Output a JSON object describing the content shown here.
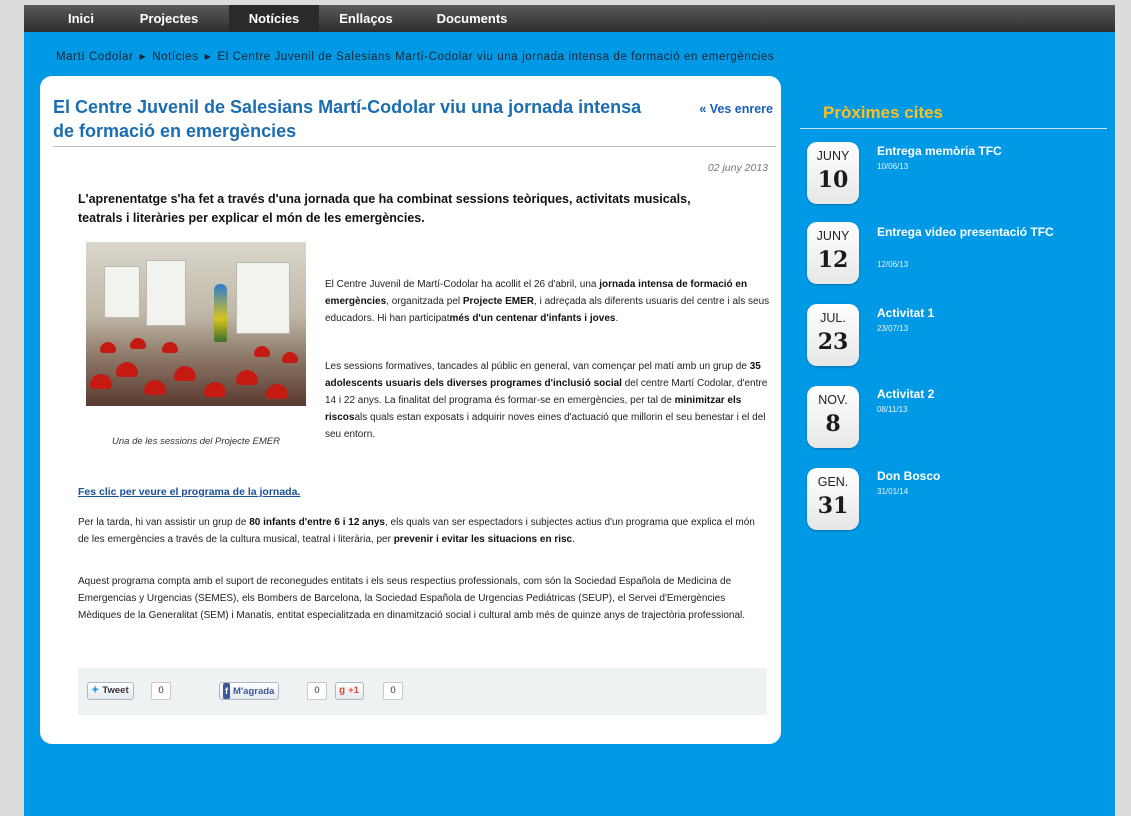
{
  "nav": {
    "items": [
      {
        "label": "Inici"
      },
      {
        "label": "Projectes"
      },
      {
        "label": "Notícies"
      },
      {
        "label": "Enllaços"
      },
      {
        "label": "Documents"
      }
    ],
    "active": "Notícies"
  },
  "breadcrumb": {
    "items": [
      "Martí Codolar",
      "Notícies",
      "El Centre Juvenil de Salesians Martí-Codolar viu una jornada intensa de formació en emergències"
    ],
    "separator": "▶"
  },
  "article": {
    "title": "El Centre Juvenil de Salesians Martí-Codolar viu una jornada intensa de formació en emergències",
    "back_link": "« Ves enrere",
    "date": "02 juny 2013",
    "lead": "L'aprenentatge s'ha fet a través d'una jornada que ha combinat sessions teòriques, activitats musicals, teatrals i literàries per explicar el món de les emergències.",
    "image_caption": "Una de les sessions del Projecte EMER",
    "p1": [
      {
        "t": "El Centre Juvenil de Martí-Codolar ha acollit  el 26 d'abril, una "
      },
      {
        "t": "jornada intensa de formació en emergències",
        "b": true
      },
      {
        "t": ", organitzada pel "
      },
      {
        "t": "Projecte EMER",
        "b": true
      },
      {
        "t": ", i adreçada als diferents usuaris del centre i als seus educadors.  Hi han participat"
      },
      {
        "t": "més d'un centenar d'infants i joves",
        "b": true
      },
      {
        "t": "."
      }
    ],
    "p2": [
      {
        "t": "Les sessions formatives, tancades al públic en general, van començar pel matí amb un grup de "
      },
      {
        "t": "35 adolescents usuaris dels diverses programes d'inclusió social",
        "b": true
      },
      {
        "t": " del centre Martí Codolar, d'entre 14 i 22 anys. La finalitat del programa és formar-se en emergències, per tal de "
      },
      {
        "t": "minimitzar els riscos",
        "b": true
      },
      {
        "t": "als quals estan exposats i adquirir noves eines d'actuació que millorin el seu benestar i el del seu entorn."
      }
    ],
    "program_link": "Fes clic per veure el programa de la jornada.",
    "p3": [
      {
        "t": "Per la tarda, hi van assistir un grup de "
      },
      {
        "t": "80 infants d'entre 6 i 12 anys",
        "b": true
      },
      {
        "t": ", els quals van ser espectadors i subjectes actius d'un programa que explica el món de les emergències a través de la cultura musical, teatral i literària, per "
      },
      {
        "t": "prevenir i evitar les situacions en risc",
        "b": true
      },
      {
        "t": "."
      }
    ],
    "p4": [
      {
        "t": "Aquest programa compta amb el suport de reconegudes entitats i els seus respectius professionals, com són la Sociedad Española de Medicina de Emergencias y Urgencias (SEMES), els Bombers de Barcelona, la Sociedad Española de Urgencias Pediátricas (SEUP), el Servei d'Emergències Mèdiques de la Generalitat (SEM) i Manatis, entitat especialitzada en dinamització social i cultural amb més de quinze anys de trajectòria professional."
      }
    ]
  },
  "share": {
    "tweet_label": "Tweet",
    "tweet_count": "0",
    "like_label": "M'agrada",
    "like_count": "0",
    "gplus_label": "+1",
    "gplus_count": "0"
  },
  "sidebar": {
    "title": "Pròximes cites",
    "events": [
      {
        "month": "JUNY",
        "day": "10",
        "title": "Entrega memòria TFC",
        "date": "10/06/13"
      },
      {
        "month": "JUNY",
        "day": "12",
        "title": "Entrega video presentació TFC",
        "date": "12/06/13"
      },
      {
        "month": "JUL.",
        "day": "23",
        "title": "Activitat 1",
        "date": "23/07/13"
      },
      {
        "month": "NOV.",
        "day": "8",
        "title": "Activitat 2",
        "date": "08/11/13"
      },
      {
        "month": "GEN.",
        "day": "31",
        "title": "Don Bosco",
        "date": "31/01/14"
      }
    ]
  },
  "colors": {
    "page_bg": "#0099e6",
    "nav_bg": "#3a3a3a",
    "title_blue": "#1a6db0",
    "sidebar_title": "#ffbf1f"
  },
  "icons": {
    "twitter": "twitter-bird-icon",
    "facebook": "facebook-icon",
    "gplus": "google-plus-icon"
  }
}
